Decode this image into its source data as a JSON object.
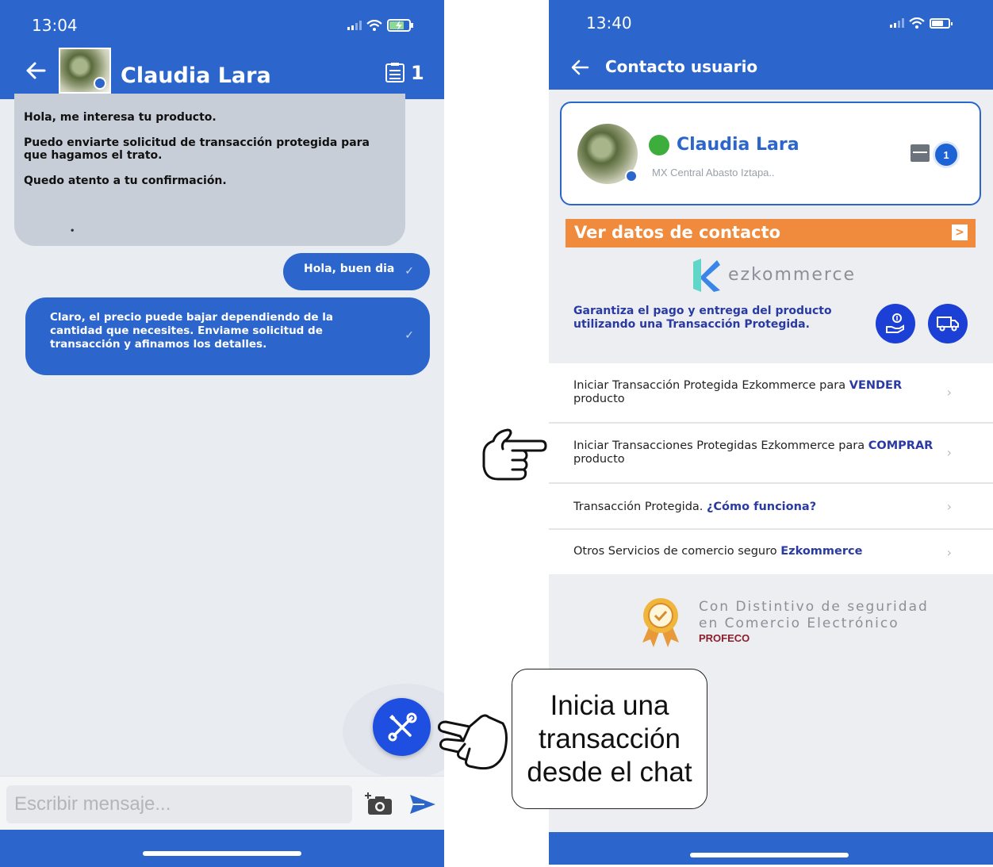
{
  "left_screen": {
    "status_time": "13:04",
    "contact_name": "Claudia Lara",
    "notes_count": "1",
    "messages": [
      {
        "direction": "incoming",
        "paragraphs": [
          "Hola, me interesa tu producto.",
          "Puedo enviarte solicitud de transacción protegida para que hagamos el trato.",
          "Quedo atento a tu confirmación."
        ]
      },
      {
        "direction": "outgoing",
        "text": "Hola, buen dia"
      },
      {
        "direction": "outgoing",
        "text": "Claro, el precio puede bajar dependiendo de la cantidad que necesites. Enviame solicitud de transacción y afinamos los detalles."
      }
    ],
    "input_placeholder": "Escribir mensaje...",
    "tick": "✓"
  },
  "right_screen": {
    "status_time": "13:40",
    "title": "Contacto usuario",
    "contact": {
      "name": "Claudia Lara",
      "location": "MX Central Abasto Iztapa..",
      "badge_count": "1",
      "online_color": "#3dae3b"
    },
    "contact_button": "Ver datos de contacto",
    "brand_name": "ezkommerce",
    "guarantee_text": "Garantiza el pago y entrega del producto utilizando una Transacción Protegida.",
    "menu": [
      {
        "text": "Iniciar Transacción Protegida Ezkommerce para ",
        "highlight": "VENDER",
        "tail": " producto"
      },
      {
        "text": "Iniciar Transacciones Protegidas Ezkommerce para ",
        "highlight": "COMPRAR",
        "tail": " producto"
      },
      {
        "text": "Transacción Protegida. ",
        "highlight": "¿Cómo funciona?",
        "tail": ""
      },
      {
        "text": "Otros Servicios de comercio seguro ",
        "highlight": "Ezkommerce",
        "tail": ""
      }
    ],
    "seal_line1": "Con Distintivo de seguridad",
    "seal_line2": "en Comercio Electrónico",
    "seal_brand": "PROFECO"
  },
  "callout_text": "Inicia una transacción desde el chat",
  "colors": {
    "primary_blue": "#2c66cc",
    "fab_blue": "#1f4fe0",
    "orange": "#f08a3c",
    "link_navy": "#2a3aa3",
    "profeco_red": "#8b1f2c"
  }
}
